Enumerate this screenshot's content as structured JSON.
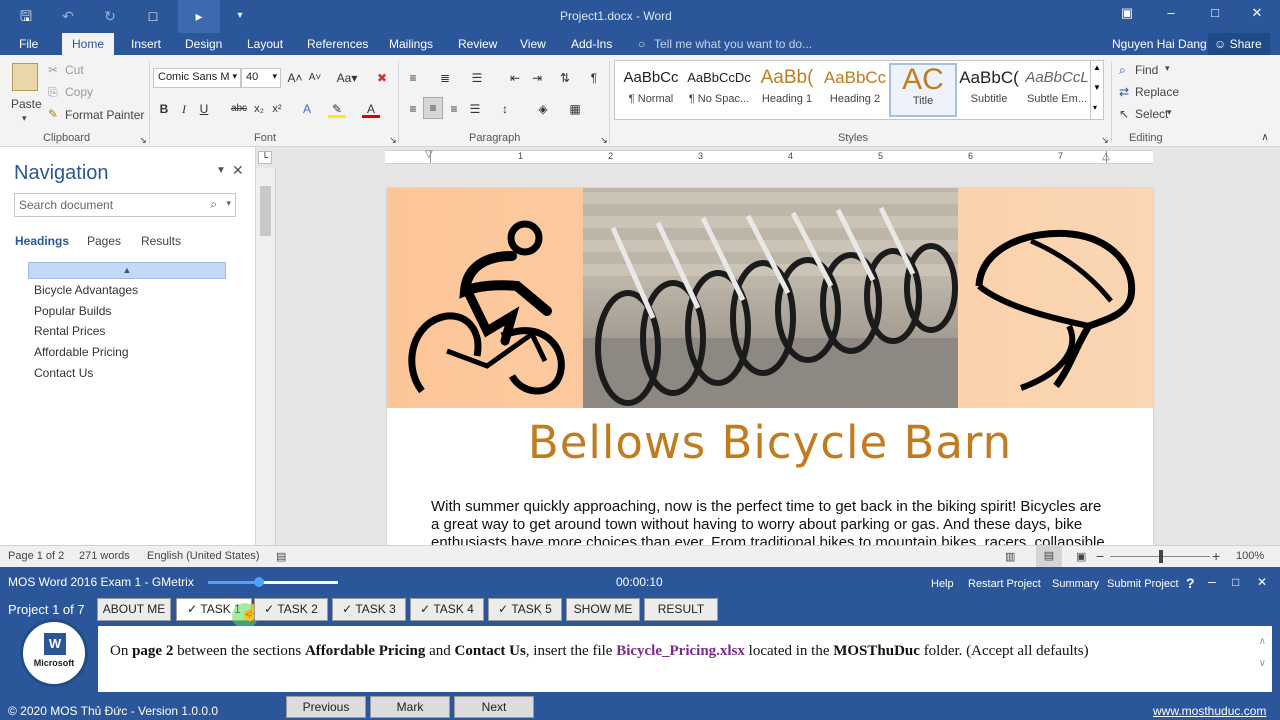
{
  "window": {
    "title": "Project1.docx - Word"
  },
  "tabs": [
    "File",
    "Home",
    "Insert",
    "Design",
    "Layout",
    "References",
    "Mailings",
    "Review",
    "View",
    "Add-Ins"
  ],
  "tell_me": "Tell me what you want to do...",
  "user": "Nguyen Hai Dang",
  "share": "Share",
  "clipboard": {
    "paste": "Paste",
    "cut": "Cut",
    "copy": "Copy",
    "format_painter": "Format Painter",
    "label": "Clipboard"
  },
  "font": {
    "name": "Comic Sans M",
    "size": "40",
    "label": "Font"
  },
  "paragraph": {
    "label": "Paragraph"
  },
  "styles": {
    "label": "Styles",
    "items": [
      {
        "preview": "AaBbCc",
        "name": "¶ Normal"
      },
      {
        "preview": "AaBbCcDc",
        "name": "¶ No Spac..."
      },
      {
        "preview": "AaBb(",
        "name": "Heading 1"
      },
      {
        "preview": "AaBbCc",
        "name": "Heading 2"
      },
      {
        "preview": "AC",
        "name": "Title"
      },
      {
        "preview": "AaBbC(",
        "name": "Subtitle"
      },
      {
        "preview": "AaBbCcL",
        "name": "Subtle Em..."
      }
    ]
  },
  "editing": {
    "find": "Find",
    "replace": "Replace",
    "select": "Select",
    "label": "Editing"
  },
  "navigation": {
    "title": "Navigation",
    "search_placeholder": "Search document",
    "tabs": [
      "Headings",
      "Pages",
      "Results"
    ],
    "headings": [
      "Bicycle Advantages",
      "Popular Builds",
      "Rental Prices",
      "Affordable Pricing",
      "Contact Us"
    ]
  },
  "document": {
    "title": "Bellows Bicycle Barn",
    "body": "With summer quickly approaching, now is the perfect time to get back in the biking spirit! Bicycles are a great way to get around town without having to worry about parking or gas. And these days, bike enthusiasts have more choices than ever. From traditional bikes to mountain bikes, racers, collapsible"
  },
  "ruler": [
    "1",
    "2",
    "3",
    "4",
    "5",
    "6",
    "7"
  ],
  "status": {
    "page": "Page 1 of 2",
    "words": "271 words",
    "language": "English (United States)",
    "zoom": "100%"
  },
  "gmetrix": {
    "title": "MOS Word 2016 Exam 1 - GMetrix",
    "timer": "00:00:10",
    "menu": [
      "Help",
      "Restart Project",
      "Summary",
      "Submit Project"
    ],
    "project": "Project 1 of 7",
    "buttons": [
      "ABOUT ME",
      "TASK 1",
      "TASK 2",
      "TASK 3",
      "TASK 4",
      "TASK 5",
      "SHOW ME",
      "RESULT"
    ],
    "instruction": {
      "p1": "On ",
      "b1": "page 2",
      "p2": " between the sections ",
      "b2": "Affordable Pricing",
      "p3": " and ",
      "b3": "Contact Us",
      "p4": ", insert the file ",
      "file": "Bicycle_Pricing.xlsx",
      "p5": " located in the ",
      "b4": "MOSThuDuc",
      "p6": " folder. (Accept all defaults)"
    },
    "nav": [
      "Previous",
      "Mark Complete",
      "Next"
    ],
    "footer": "© 2020 MOS Thủ Đức - Version 1.0.0.0",
    "website": "www.mosthuduc.com",
    "logo_text": "Microsoft"
  },
  "colors": {
    "accent": "#2b579a",
    "title": "#c07c1f",
    "file": "#7b2a8c"
  }
}
